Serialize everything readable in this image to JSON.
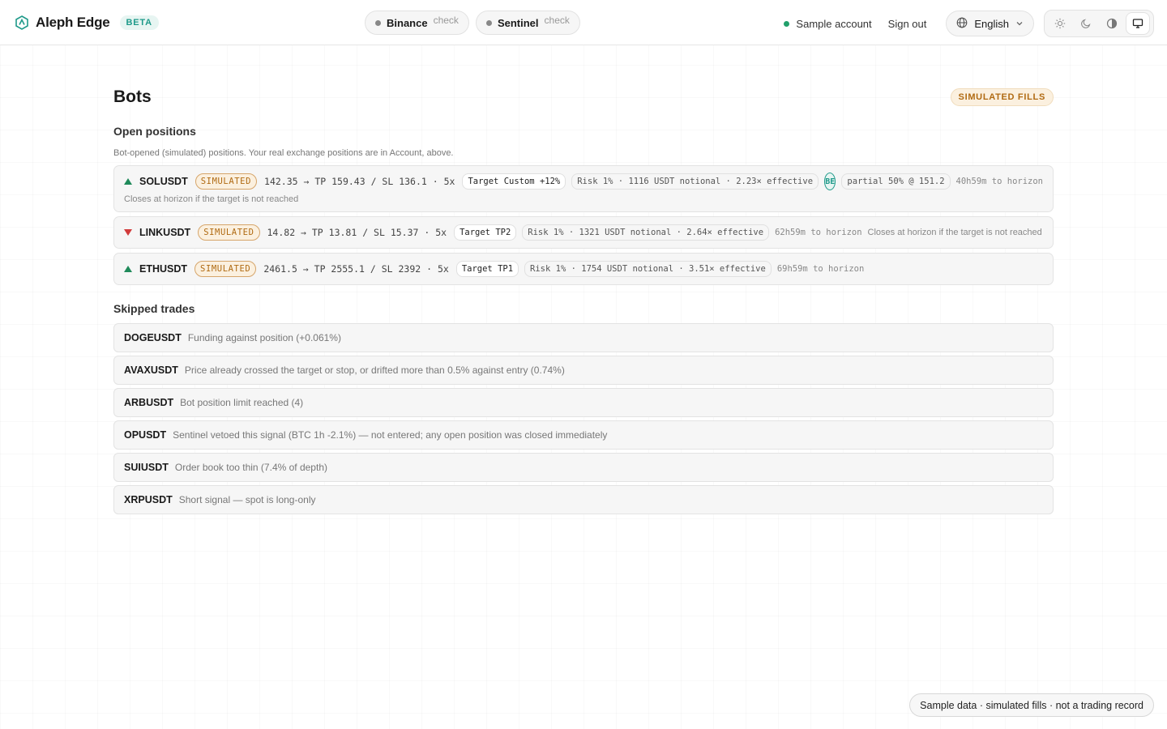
{
  "header": {
    "brand": "Aleph Edge",
    "beta": "BETA",
    "exchanges": [
      {
        "name": "Binance",
        "status": "check"
      },
      {
        "name": "Sentinel",
        "status": "check"
      }
    ],
    "account": "Sample account",
    "sign_out": "Sign out",
    "language": "English",
    "theme_icons": [
      "sun-icon",
      "moon-icon",
      "contrast-icon",
      "monitor-icon"
    ],
    "active_theme": "monitor-icon"
  },
  "page": {
    "title": "Bots",
    "badge": "SIMULATED FILLS"
  },
  "open_positions": {
    "title": "Open positions",
    "description": "Bot-opened (simulated) positions. Your real exchange positions are in Account, above.",
    "items": [
      {
        "direction": "up",
        "symbol": "SOLUSDT",
        "tag": "SIMULATED",
        "levels": "142.35 → TP 159.43 / SL 136.1 · 5x",
        "target": "Target Custom +12%",
        "risk": "Risk 1% · 1116 USDT notional · 2.23× effective",
        "be": "BE",
        "partial": "partial 50% @ 151.2",
        "horizon": "40h59m to horizon",
        "closes": "Closes at horizon if the target is not reached"
      },
      {
        "direction": "down",
        "symbol": "LINKUSDT",
        "tag": "SIMULATED",
        "levels": "14.82 → TP 13.81 / SL 15.37 · 5x",
        "target": "Target TP2",
        "risk": "Risk 1% · 1321 USDT notional · 2.64× effective",
        "horizon": "62h59m to horizon",
        "closes": "Closes at horizon if the target is not reached"
      },
      {
        "direction": "up",
        "symbol": "ETHUSDT",
        "tag": "SIMULATED",
        "levels": "2461.5 → TP 2555.1 / SL 2392 · 5x",
        "target": "Target TP1",
        "risk": "Risk 1% · 1754 USDT notional · 3.51× effective",
        "horizon": "69h59m to horizon"
      }
    ]
  },
  "skipped": {
    "title": "Skipped trades",
    "items": [
      {
        "symbol": "DOGEUSDT",
        "reason": "Funding against position (+0.061%)"
      },
      {
        "symbol": "AVAXUSDT",
        "reason": "Price already crossed the target or stop, or drifted more than 0.5% against entry (0.74%)"
      },
      {
        "symbol": "ARBUSDT",
        "reason": "Bot position limit reached (4)"
      },
      {
        "symbol": "OPUSDT",
        "reason": "Sentinel vetoed this signal (BTC 1h -2.1%) — not entered; any open position was closed immediately"
      },
      {
        "symbol": "SUIUSDT",
        "reason": "Order book too thin (7.4% of depth)"
      },
      {
        "symbol": "XRPUSDT",
        "reason": "Short signal — spot is long-only"
      }
    ]
  },
  "footer": {
    "note": "Sample data · simulated fills · not a trading record"
  },
  "colors": {
    "accent": "#1f9a8a",
    "long": "#1f8a5a",
    "short": "#d13b3b",
    "simulated": "#b06a12"
  }
}
